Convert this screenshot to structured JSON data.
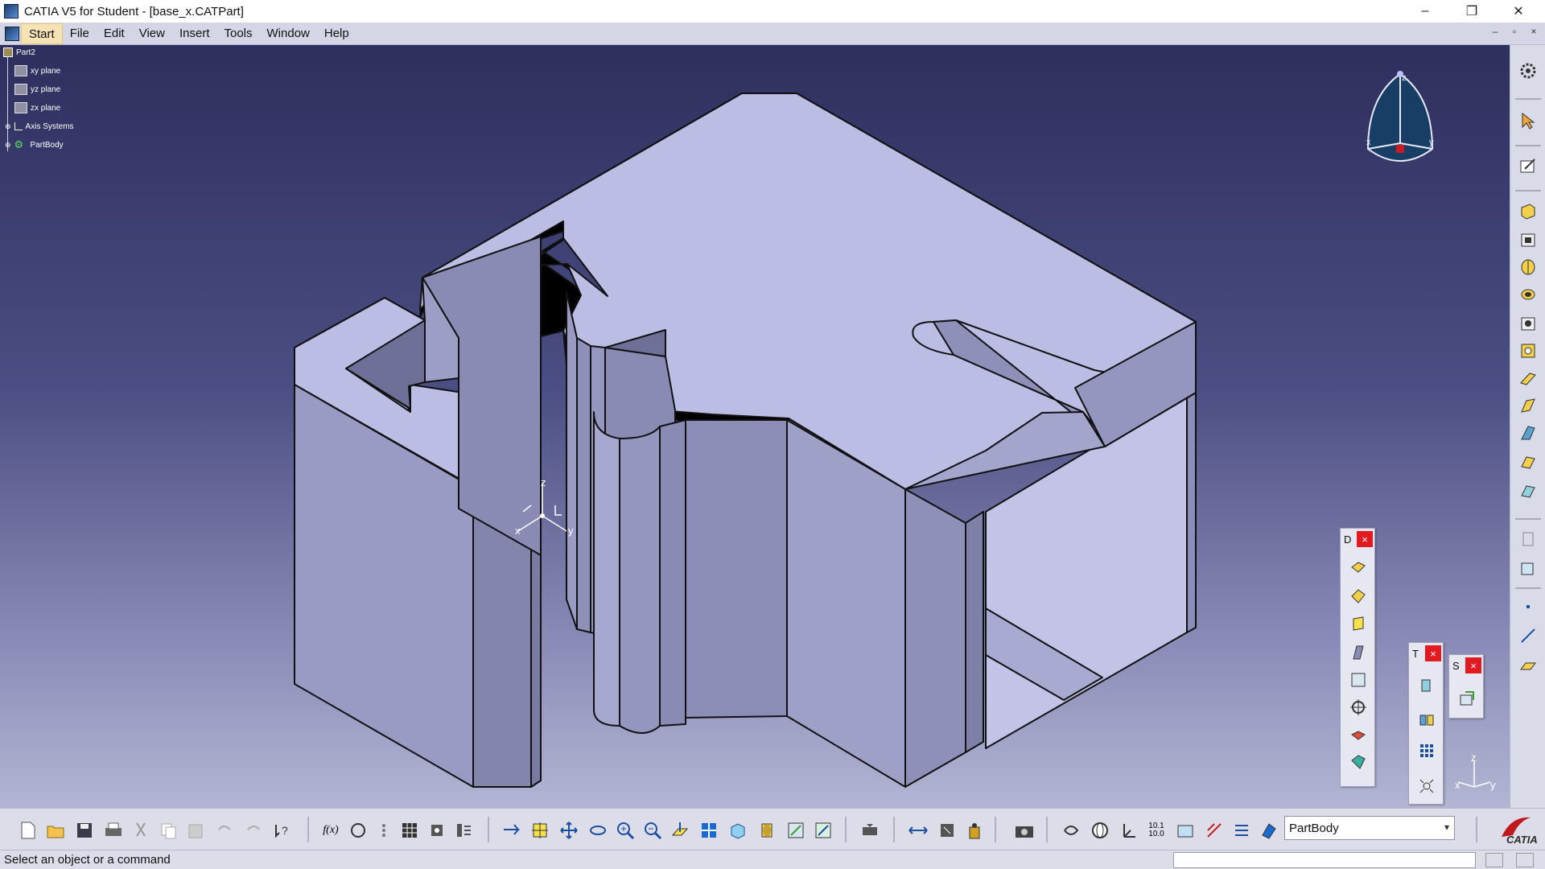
{
  "window": {
    "title": "CATIA V5 for Student - [base_x.CATPart]",
    "minimize_glyph": "–",
    "restore_glyph": "❐",
    "close_glyph": "✕"
  },
  "menubar": {
    "items": [
      "Start",
      "File",
      "Edit",
      "View",
      "Insert",
      "Tools",
      "Window",
      "Help"
    ],
    "doc_min": "–",
    "doc_restore": "▫",
    "doc_close": "×"
  },
  "tree": {
    "root": "Part2",
    "nodes": [
      "xy plane",
      "yz plane",
      "zx plane",
      "Axis Systems",
      "PartBody"
    ]
  },
  "viewport": {
    "origin_labels": {
      "x": "x",
      "y": "y",
      "z": "z"
    },
    "compass_labels": {
      "x": "x",
      "y": "y",
      "z": "z"
    },
    "mini_axis_labels": {
      "x": "x",
      "y": "y",
      "z": "z"
    }
  },
  "panels": {
    "dress_up": {
      "letter": "D",
      "close": "×"
    },
    "transform": {
      "letter": "T",
      "close": "×"
    },
    "surface": {
      "letter": "S",
      "close": "×"
    }
  },
  "toolbar": {
    "current_body": "PartBody",
    "formula_label": "f(x)",
    "measure_label": "10.1 10.0"
  },
  "status": {
    "message": "Select an object or a command"
  },
  "colors": {
    "face_light": "#bcbde4",
    "face_mid": "#9a9bc4",
    "face_dark": "#7e7fa8",
    "background_top": "#2d2f5e",
    "background_bottom": "#b3b5d3",
    "accent_close": "#e21b23"
  },
  "icons": [
    "gear-icon",
    "select-arrow-icon",
    "sketch-icon",
    "pad-icon",
    "pocket-icon",
    "shaft-icon",
    "groove-icon",
    "hole-icon",
    "rib-icon",
    "slot-icon",
    "stiffener-icon",
    "loft-icon",
    "point-icon",
    "line-icon",
    "plane-icon",
    "new-icon",
    "open-icon",
    "save-icon",
    "print-icon",
    "cut-icon",
    "copy-icon",
    "paste-icon",
    "undo-icon",
    "redo-icon",
    "whats-this-icon",
    "fly-icon",
    "fit-all-icon",
    "pan-icon",
    "rotate-icon",
    "zoom-in-icon",
    "zoom-out-icon",
    "normal-view-icon",
    "multi-view-icon",
    "iso-view-icon",
    "shading-icon",
    "hide-show-icon",
    "swap-space-icon",
    "update-icon",
    "measure-icon",
    "camera-icon",
    "catia-logo"
  ]
}
